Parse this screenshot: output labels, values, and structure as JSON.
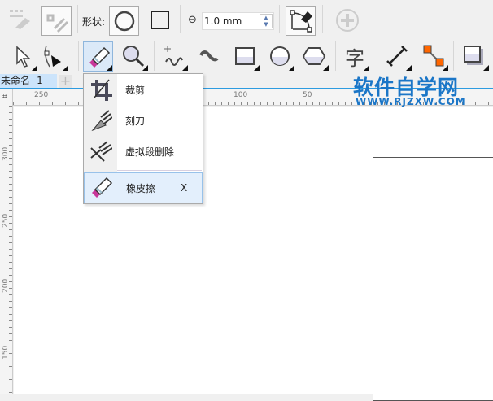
{
  "toolbar_top": {
    "shape_label": "形状:",
    "thickness_value": "1.0 mm"
  },
  "document_tab": {
    "label": "未命名 -1",
    "add_label": "+"
  },
  "ruler": {
    "h_labels": [
      "250",
      "100",
      "50"
    ],
    "v_labels": [
      "300",
      "250",
      "200",
      "150"
    ]
  },
  "flyout": {
    "items": [
      {
        "label": "裁剪",
        "icon": "crop-icon"
      },
      {
        "label": "刻刀",
        "icon": "knife-icon"
      },
      {
        "label": "虚拟段删除",
        "icon": "virtual-segment-delete-icon"
      },
      {
        "label": "橡皮擦",
        "shortcut": "X",
        "icon": "eraser-icon",
        "selected": true
      }
    ]
  },
  "watermark": {
    "title": "软件自学网",
    "url": "WWW.RJZXW.COM"
  },
  "colors": {
    "accent": "#2d9be0",
    "tab_bg": "#cce4fb",
    "eraser_pink": "#c8379a",
    "watermark": "#1b76c7"
  }
}
